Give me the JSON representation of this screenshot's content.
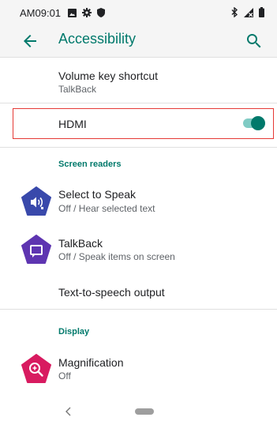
{
  "status_bar": {
    "time": "AM09:01",
    "left_icons": [
      "image-icon",
      "gear-icon",
      "shield-icon"
    ],
    "right_icons": [
      "bluetooth-icon",
      "no-signal-icon",
      "battery-icon"
    ]
  },
  "app_bar": {
    "title": "Accessibility",
    "back_icon": "arrow-back-icon",
    "search_icon": "search-icon"
  },
  "items": {
    "volume_key": {
      "title": "Volume key shortcut",
      "subtitle": "TalkBack"
    },
    "hdmi": {
      "title": "HDMI",
      "toggle_on": true
    },
    "screen_readers_header": "Screen readers",
    "select_to_speak": {
      "title": "Select to Speak",
      "subtitle": "Off / Hear selected text",
      "icon": "speaker-icon"
    },
    "talkback": {
      "title": "TalkBack",
      "subtitle": "Off / Speak items on screen",
      "icon": "chat-icon"
    },
    "tts": {
      "title": "Text-to-speech output"
    },
    "display_header": "Display",
    "magnification": {
      "title": "Magnification",
      "subtitle": "Off",
      "icon": "magnify-icon"
    }
  },
  "colors": {
    "accent": "#00796b",
    "select_to_speak_icon": "#3949ab",
    "talkback_icon": "#5e35b1",
    "magnification_icon": "#d81b60",
    "highlight_border": "#e53935"
  },
  "nav_bar": {
    "back_icon": "nav-back-icon",
    "home_icon": "nav-home-pill"
  }
}
